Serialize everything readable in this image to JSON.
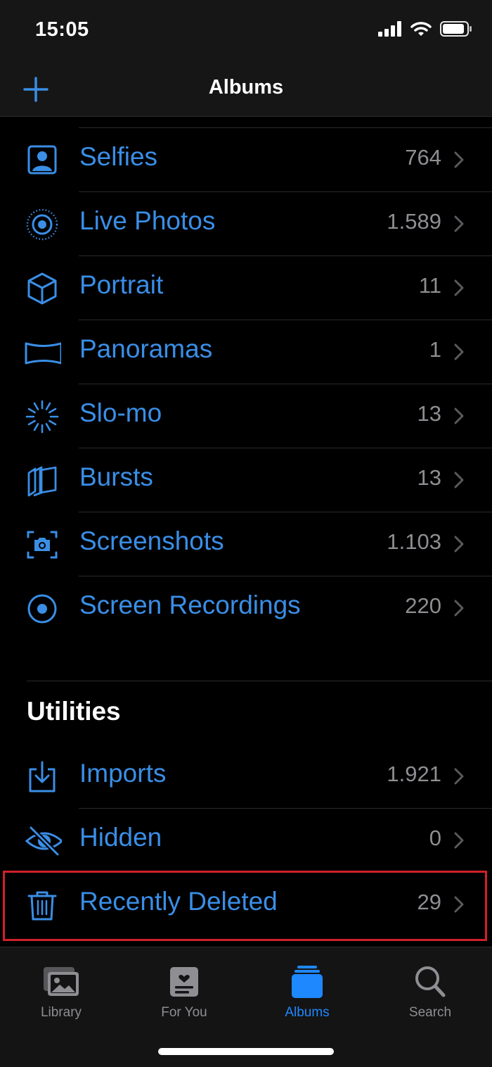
{
  "status": {
    "time": "15:05"
  },
  "nav": {
    "title": "Albums"
  },
  "media_types": [
    {
      "label": "Selfies",
      "count": "764",
      "icon": "selfie-icon"
    },
    {
      "label": "Live Photos",
      "count": "1.589",
      "icon": "live-photos-icon"
    },
    {
      "label": "Portrait",
      "count": "11",
      "icon": "cube-icon"
    },
    {
      "label": "Panoramas",
      "count": "1",
      "icon": "panorama-icon"
    },
    {
      "label": "Slo-mo",
      "count": "13",
      "icon": "slomo-icon"
    },
    {
      "label": "Bursts",
      "count": "13",
      "icon": "bursts-icon"
    },
    {
      "label": "Screenshots",
      "count": "1.103",
      "icon": "screenshot-icon"
    },
    {
      "label": "Screen Recordings",
      "count": "220",
      "icon": "record-icon"
    }
  ],
  "utilities": {
    "title": "Utilities",
    "items": [
      {
        "label": "Imports",
        "count": "1.921",
        "icon": "import-icon"
      },
      {
        "label": "Hidden",
        "count": "0",
        "icon": "eye-slash-icon"
      },
      {
        "label": "Recently Deleted",
        "count": "29",
        "icon": "trash-icon"
      }
    ]
  },
  "tabs": [
    {
      "label": "Library",
      "icon": "library-icon",
      "active": false
    },
    {
      "label": "For You",
      "icon": "for-you-icon",
      "active": false
    },
    {
      "label": "Albums",
      "icon": "albums-icon",
      "active": true
    },
    {
      "label": "Search",
      "icon": "search-icon",
      "active": false
    }
  ],
  "colors": {
    "accent": "#3a8ee6",
    "tab_active": "#1e88ff",
    "secondary_text": "#8e8e93",
    "highlight_border": "#d0202a"
  }
}
